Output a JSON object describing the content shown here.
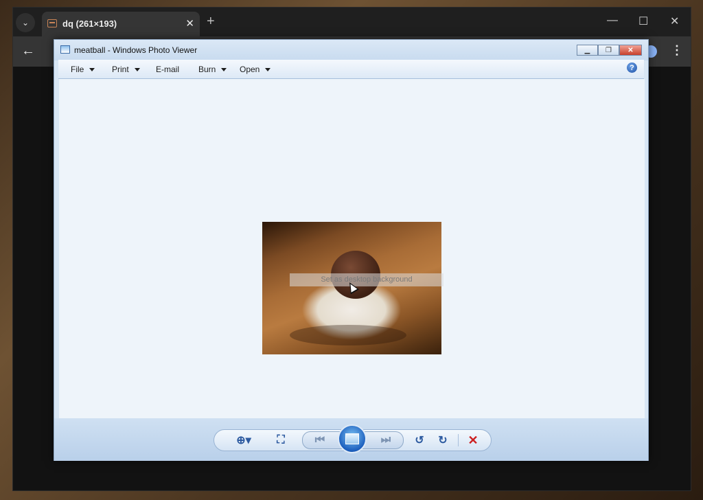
{
  "browser": {
    "tab_title": "dq (261×193)",
    "icons": [
      "tab-search-icon",
      "favicon-icon",
      "close-icon",
      "plus-icon",
      "minimize-icon",
      "maximize-icon",
      "close-icon",
      "back-arrow-icon",
      "profile-icon",
      "menu-dots-icon"
    ]
  },
  "viewer": {
    "title": "meatball - Windows Photo Viewer",
    "menu": {
      "file": "File",
      "print": "Print",
      "email": "E-mail",
      "burn": "Burn",
      "open": "Open"
    },
    "help": "?",
    "tooltip": "Set as desktop background",
    "controls": [
      "zoom-icon",
      "fit-to-window-icon",
      "previous-icon",
      "slideshow-icon",
      "next-icon",
      "rotate-counterclockwise-icon",
      "rotate-clockwise-icon",
      "delete-icon"
    ]
  }
}
